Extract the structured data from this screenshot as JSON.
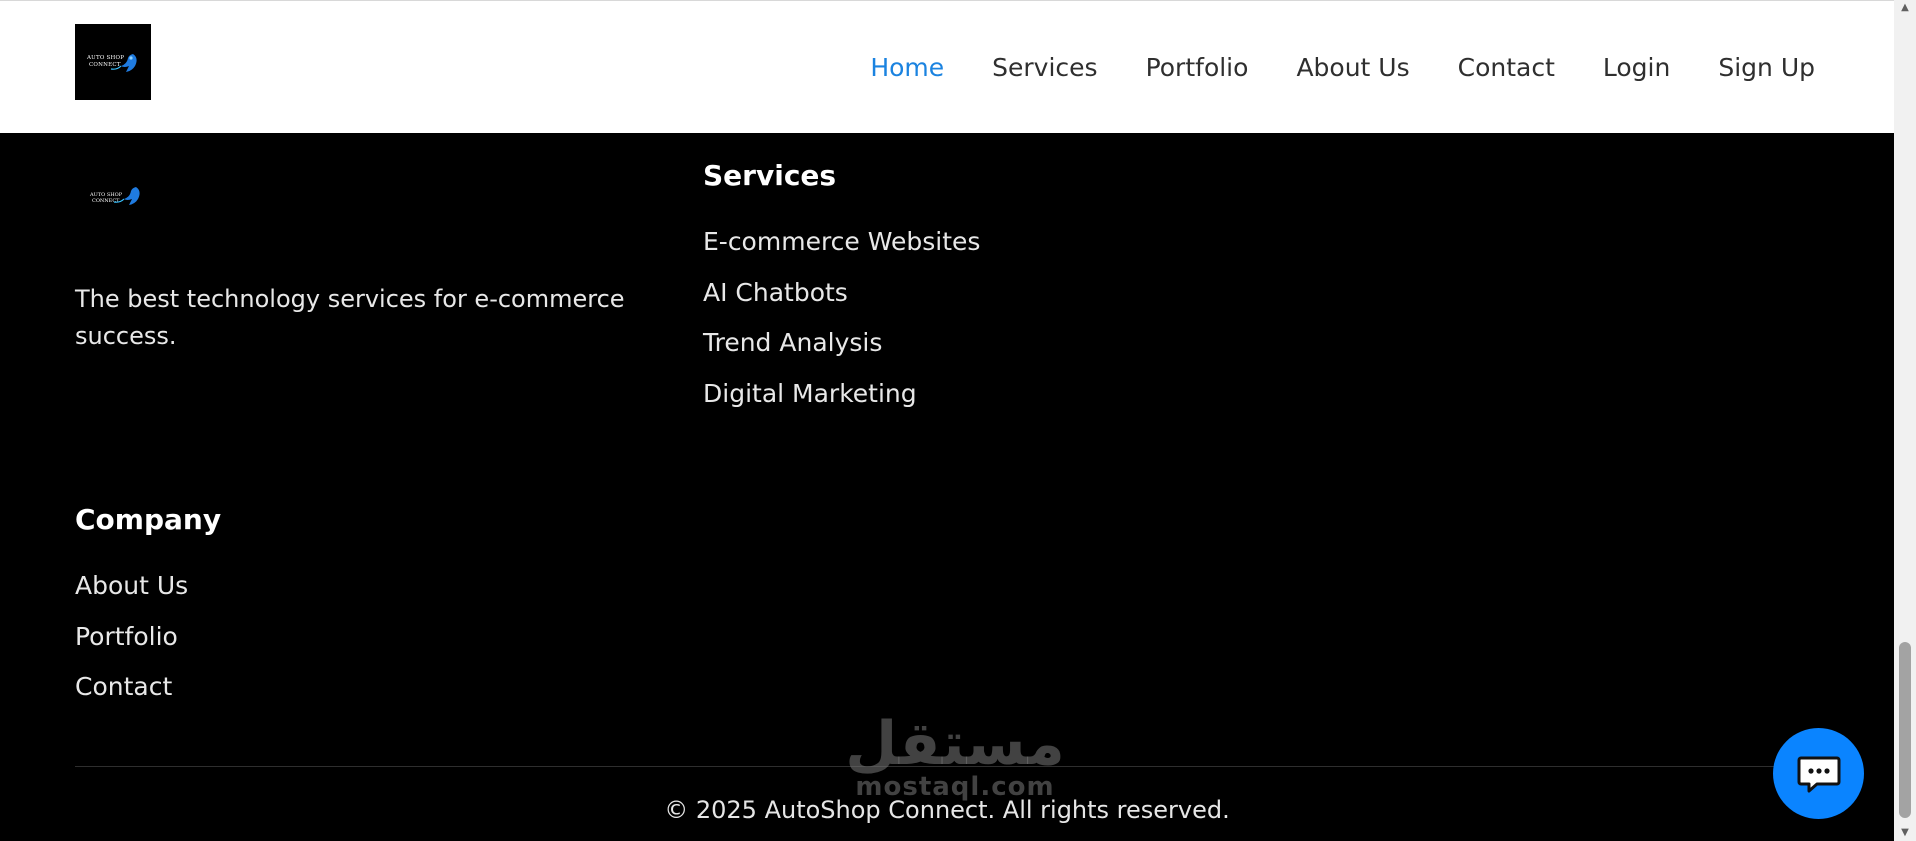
{
  "header": {
    "logo_text": [
      "AUTO SHOP",
      "CONNECT"
    ],
    "nav": [
      "Home",
      "Services",
      "Portfolio",
      "About Us",
      "Contact",
      "Login",
      "Sign Up"
    ],
    "active_nav": "Home",
    "accent_color": "#1b83e0"
  },
  "footer": {
    "tagline": "The best technology services for e-commerce success.",
    "services": {
      "title": "Services",
      "items": [
        "E-commerce Websites",
        "AI Chatbots",
        "Trend Analysis",
        "Digital Marketing"
      ]
    },
    "company": {
      "title": "Company",
      "items": [
        "About Us",
        "Portfolio",
        "Contact"
      ]
    },
    "copyright": "© 2025 AutoShop Connect. All rights reserved.",
    "watermark": {
      "arabic": "مستقل",
      "latin": "mostaql.com"
    }
  },
  "chat": {
    "icon": "chat-bubble-icon",
    "color": "#0a84ff"
  }
}
